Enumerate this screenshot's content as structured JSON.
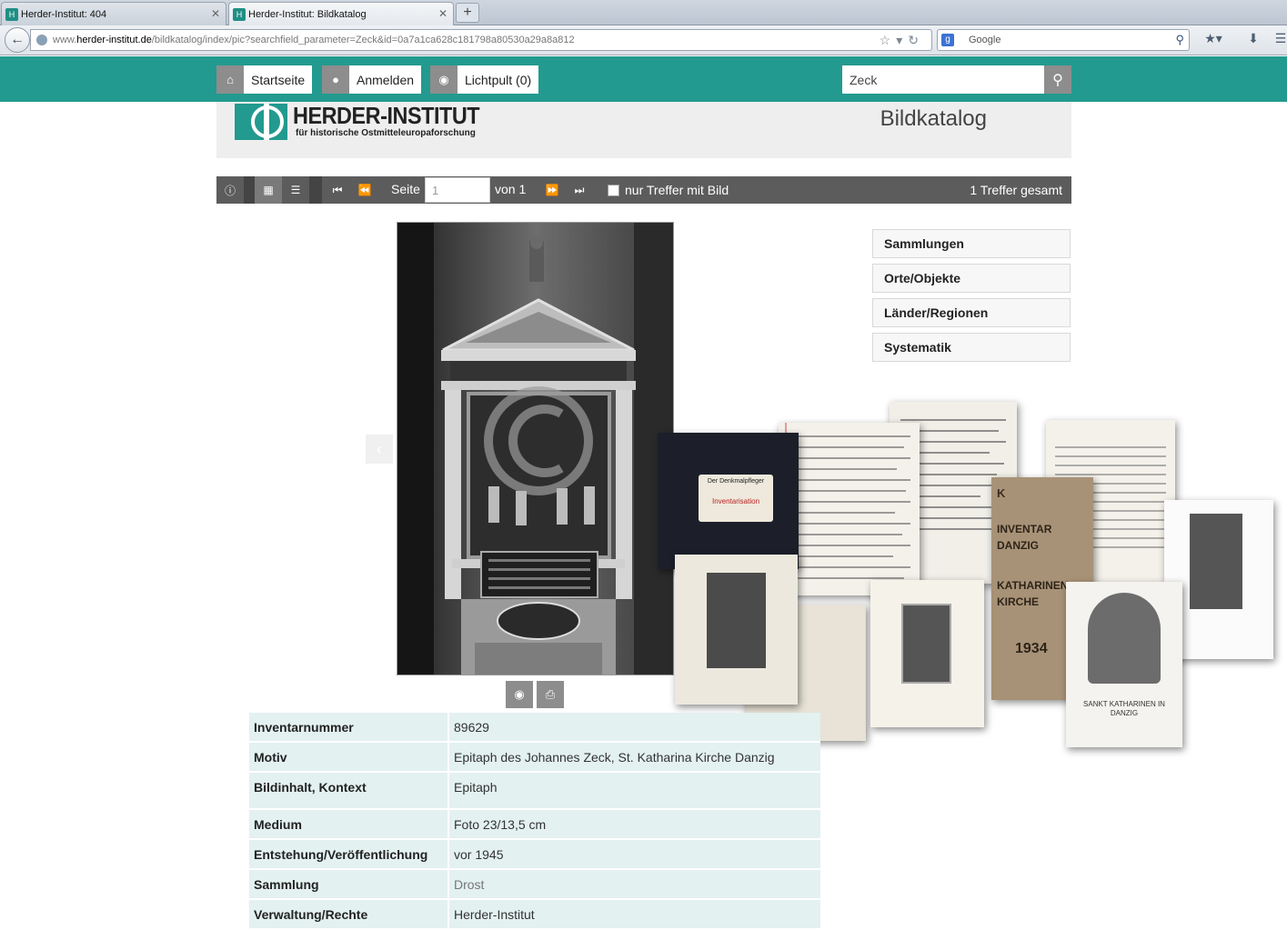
{
  "browser": {
    "tabs": [
      {
        "title": "Herder-Institut: 404"
      },
      {
        "title": "Herder-Institut: Bildkatalog"
      }
    ],
    "new_tab": "+",
    "url_prefix": "www.",
    "url_domain": "herder-institut.de",
    "url_path": "/bildkatalog/index/pic?searchfield_parameter=Zeck&id=0a7a1ca628c181798a80530a29a8a812",
    "search_engine_placeholder": "Google"
  },
  "site": {
    "nav": {
      "home": "Startseite",
      "login": "Anmelden",
      "lightbox": "Lichtpult (0)"
    },
    "search_value": "Zeck",
    "logo_title": "HERDER-INSTITUT",
    "logo_subtitle": "für historische Ostmitteleuropaforschung",
    "catalog_title": "Bildkatalog"
  },
  "toolbar": {
    "page_label": "Seite",
    "page_value": "1",
    "of_label": "von 1",
    "filter_label": "nur Treffer mit Bild",
    "total": "1 Treffer gesamt"
  },
  "side_menu": [
    "Sammlungen",
    "Orte/Objekte",
    "Länder/Regionen",
    "Systematik"
  ],
  "details": [
    {
      "key": "Inventarnummer",
      "value": "89629"
    },
    {
      "key": "Motiv",
      "value": "Epitaph des Johannes Zeck, St. Katharina Kirche Danzig"
    },
    {
      "key": "Bildinhalt, Kontext",
      "value": "Epitaph"
    },
    {
      "key": "Medium",
      "value": "Foto 23/13,5 cm"
    },
    {
      "key": "Entstehung/Veröffentlichung",
      "value": "vor 1945"
    },
    {
      "key": "Sammlung",
      "value": "Drost"
    },
    {
      "key": "Verwaltung/Rechte",
      "value": "Herder-Institut"
    }
  ],
  "collage": {
    "book_label": "Der Denkmalpfleger",
    "book_sub": "Inventarisation",
    "inventar_k": "K",
    "inventar_title": "INVENTAR DANZIG",
    "inventar_sub": "KATHARINEN KIRCHE",
    "inventar_year": "1934",
    "sankt_title": "SANKT KATHARINEN IN DANZIG",
    "colors": {
      "brand": "#239a8f",
      "cover_brown": "#a89277",
      "book_dark": "#1c1f2a"
    }
  }
}
